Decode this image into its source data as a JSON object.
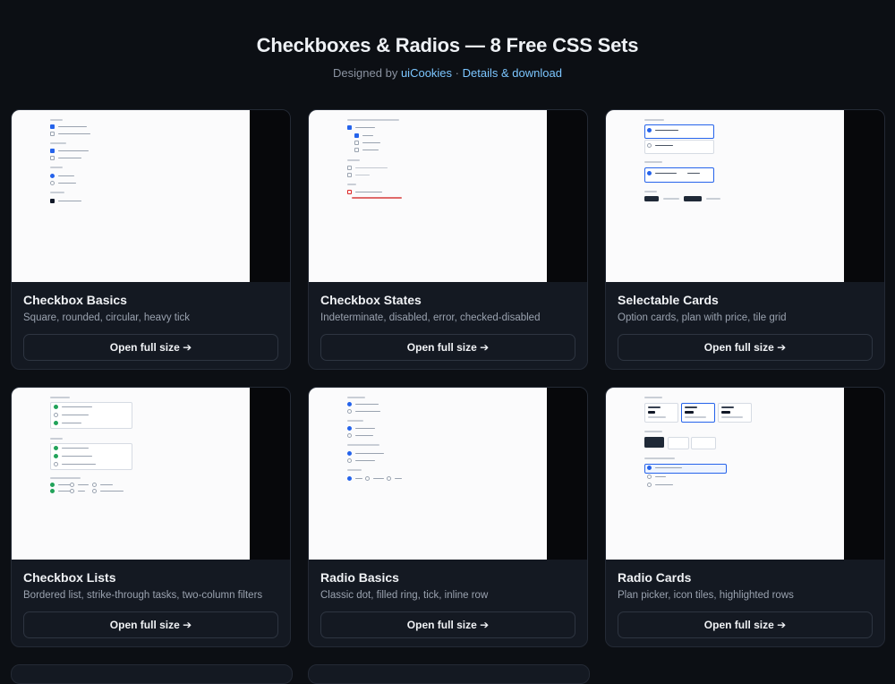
{
  "header": {
    "title": "Checkboxes & Radios — 8 Free CSS Sets",
    "designed_by": "Designed by",
    "author": "uiCookies",
    "separator": "·",
    "details_link": "Details & download"
  },
  "cards": [
    {
      "title": "Checkbox Basics",
      "desc": "Square, rounded, circular, heavy tick",
      "button": "Open full size ➔"
    },
    {
      "title": "Checkbox States",
      "desc": "Indeterminate, disabled, error, checked-disabled",
      "button": "Open full size ➔"
    },
    {
      "title": "Selectable Cards",
      "desc": "Option cards, plan with price, tile grid",
      "button": "Open full size ➔"
    },
    {
      "title": "Checkbox Lists",
      "desc": "Bordered list, strike-through tasks, two-column filters",
      "button": "Open full size ➔"
    },
    {
      "title": "Radio Basics",
      "desc": "Classic dot, filled ring, tick, inline row",
      "button": "Open full size ➔"
    },
    {
      "title": "Radio Cards",
      "desc": "Plan picker, icon tiles, highlighted rows",
      "button": "Open full size ➔"
    }
  ],
  "colors": {
    "background": "#0c0f14",
    "card": "#141922",
    "link": "#7cc6ff",
    "accent": "#2563eb"
  }
}
